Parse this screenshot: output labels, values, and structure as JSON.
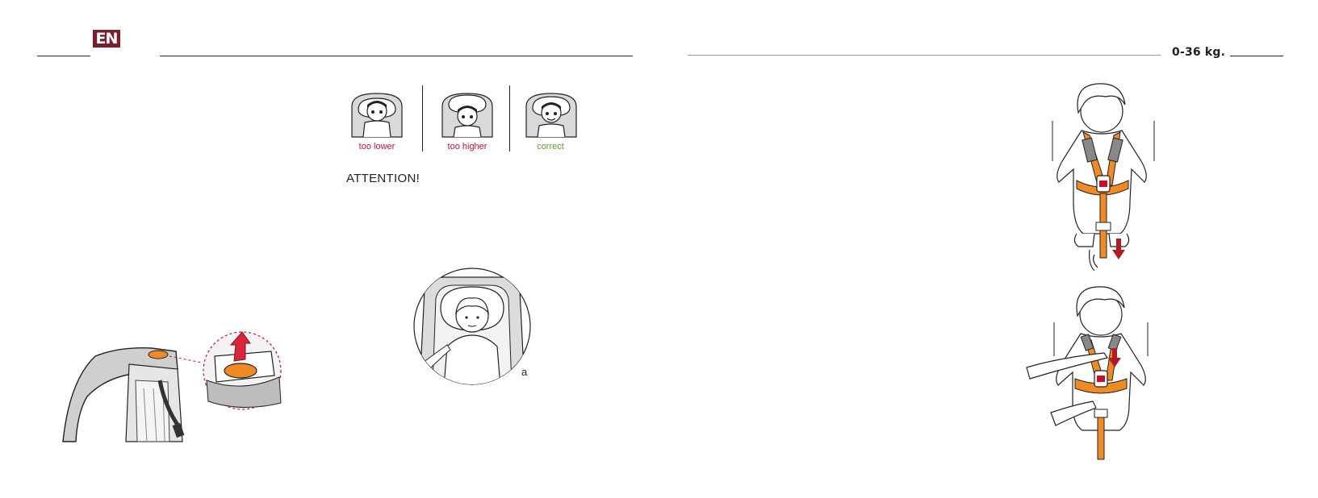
{
  "header": {
    "language_badge": "EN",
    "weight_range": "0-36 kg."
  },
  "headrest_examples": [
    {
      "caption": "too lower",
      "status": "incorrect"
    },
    {
      "caption": "too higher",
      "status": "incorrect"
    },
    {
      "caption": "correct",
      "status": "correct"
    }
  ],
  "attention_label": "ATTENTION!",
  "figure_label": "a",
  "colors": {
    "badge": "#7a1f2a",
    "incorrect_caption": "#c8102e",
    "correct_caption": "#5aa02c",
    "harness_orange": "#f08a24",
    "arrow_red": "#b31b24"
  }
}
